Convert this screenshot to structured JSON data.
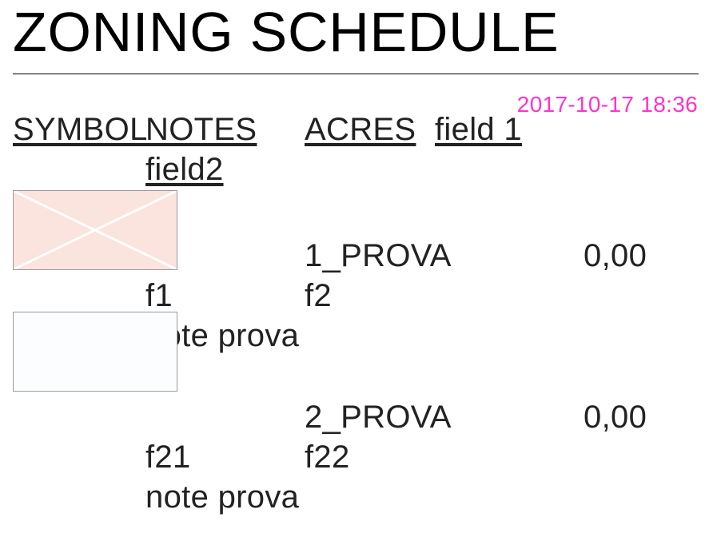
{
  "title": "ZONING SCHEDULE",
  "timestamp": "2017-10-17 18:36",
  "headers": {
    "symbol": "SYMBOL",
    "notes": "NOTES",
    "acres": "ACRES",
    "field1": "field 1",
    "field2": "field2"
  },
  "rows": [
    {
      "swatch_color": "#fbe3de",
      "acres": "1_PROVA",
      "value": "0,00",
      "f1": "f1",
      "f2": "f2",
      "note": "note prova"
    },
    {
      "swatch_color": "#fbfdff",
      "acres": "2_PROVA",
      "value": "0,00",
      "f1": "f21",
      "f2": "f22",
      "note": "note prova"
    }
  ]
}
